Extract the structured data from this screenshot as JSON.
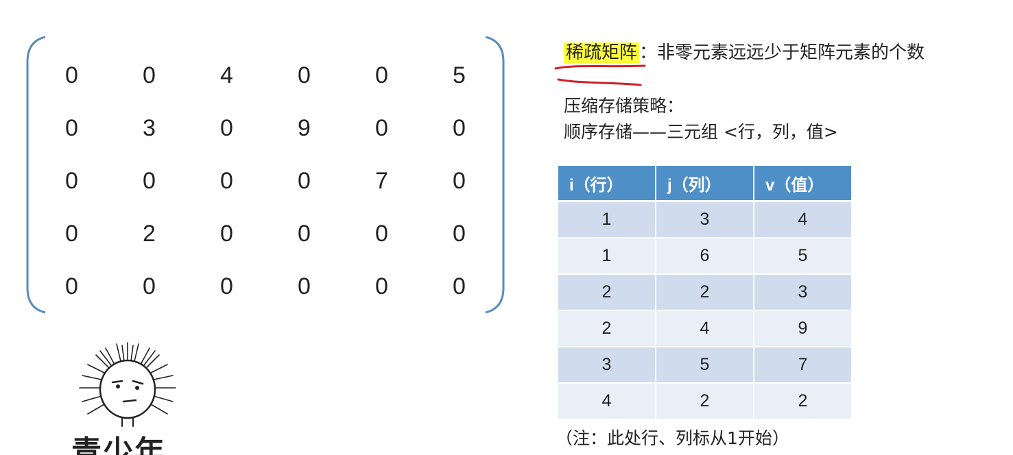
{
  "matrix": {
    "rows": [
      [
        "0",
        "0",
        "4",
        "0",
        "0",
        "5"
      ],
      [
        "0",
        "3",
        "0",
        "9",
        "0",
        "0"
      ],
      [
        "0",
        "0",
        "0",
        "0",
        "7",
        "0"
      ],
      [
        "0",
        "2",
        "0",
        "0",
        "0",
        "0"
      ],
      [
        "0",
        "0",
        "0",
        "0",
        "0",
        "0"
      ]
    ]
  },
  "definition": {
    "term": "稀疏矩阵",
    "colon": "：",
    "text": "非零元素远远少于矩阵元素的个数"
  },
  "strategy": {
    "title": "压缩存储策略：",
    "line": "顺序存储——三元组 <行，列，值>"
  },
  "triplet_table": {
    "headers": [
      "i（行）",
      "j（列）",
      "v（值）"
    ],
    "rows": [
      [
        "1",
        "3",
        "4"
      ],
      [
        "1",
        "6",
        "5"
      ],
      [
        "2",
        "2",
        "3"
      ],
      [
        "2",
        "4",
        "9"
      ],
      [
        "3",
        "5",
        "7"
      ],
      [
        "4",
        "2",
        "2"
      ]
    ]
  },
  "note": "（注：此处行、列标从1开始）",
  "cartoon": {
    "caption": "青少年"
  },
  "colors": {
    "bracket": "#5a8cc0",
    "highlight": "#ffff3b",
    "underline": "#d0202a",
    "table_header": "#4f8fc8",
    "row_dark": "#d0dcee",
    "row_light": "#e9eef7"
  }
}
